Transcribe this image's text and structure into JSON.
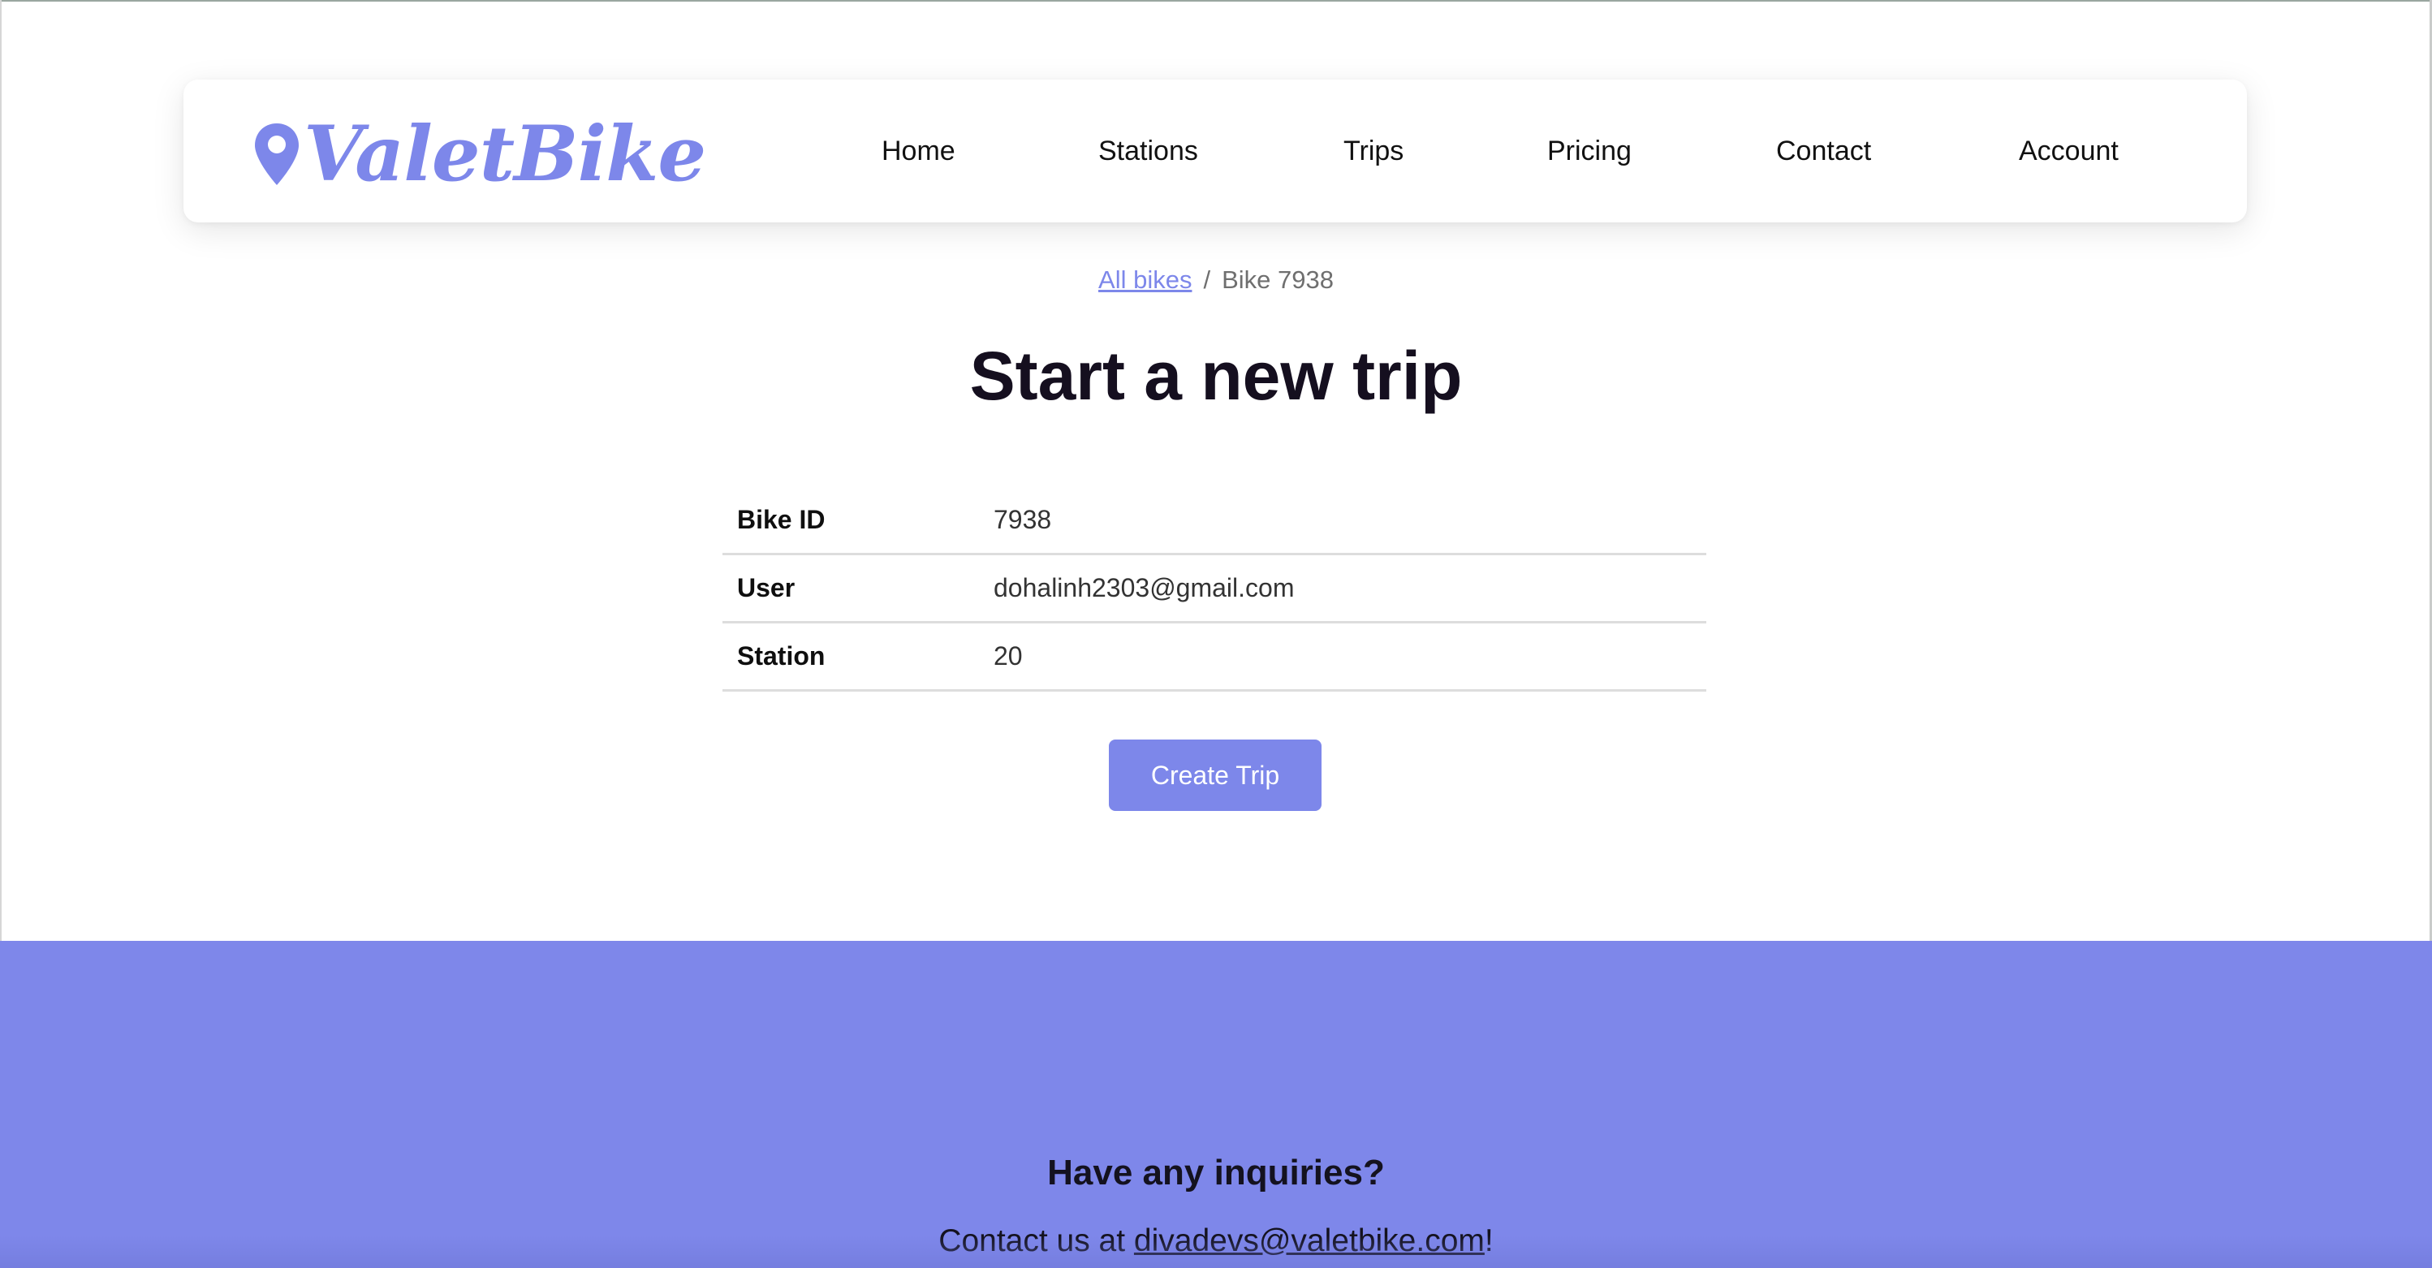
{
  "brand": {
    "name": "ValetBike",
    "color": "#7d87ea"
  },
  "nav": {
    "items": [
      {
        "label": "Home"
      },
      {
        "label": "Stations"
      },
      {
        "label": "Trips"
      },
      {
        "label": "Pricing"
      },
      {
        "label": "Contact"
      },
      {
        "label": "Account"
      }
    ]
  },
  "breadcrumb": {
    "link_label": "All bikes",
    "separator": "/",
    "current": "Bike 7938"
  },
  "page": {
    "title": "Start a new trip"
  },
  "details": {
    "rows": [
      {
        "key": "Bike ID",
        "value": "7938"
      },
      {
        "key": "User",
        "value": "dohalinh2303@gmail.com"
      },
      {
        "key": "Station",
        "value": "20"
      }
    ]
  },
  "actions": {
    "create_label": "Create Trip"
  },
  "footer": {
    "heading": "Have any inquiries?",
    "contact_prefix": "Contact us at ",
    "contact_email": "divadevs@valetbike.com",
    "contact_suffix": "!",
    "background": "#7e87ea"
  },
  "icons": {
    "logo_pin": "map-pin-icon"
  }
}
